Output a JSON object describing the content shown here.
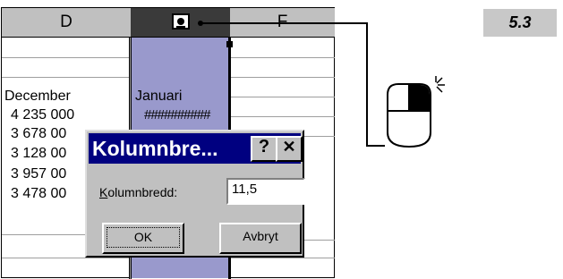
{
  "step_badge": "5.3",
  "spreadsheet": {
    "columns": [
      {
        "label": "D"
      },
      {
        "label": "",
        "selected": true
      },
      {
        "label": "F"
      }
    ],
    "header_row": {
      "d": "December",
      "e": "Januari"
    },
    "rows": [
      {
        "d": "4 235 000",
        "e": "##########"
      },
      {
        "d": "3 678 00",
        "e": ""
      },
      {
        "d": "3 128 00",
        "e": ""
      },
      {
        "d": "3 957 00",
        "e": ""
      },
      {
        "d": "3 478 00",
        "e": ""
      }
    ],
    "selected_column_color": "#9999cc"
  },
  "dialog": {
    "title": "Kolumnbre...",
    "help_button": "?",
    "close_button": "✕",
    "field_label": "Kolumnbredd:",
    "field_value": "11,5",
    "ok_label": "OK",
    "cancel_label": "Avbryt"
  },
  "icons": {
    "resize_cursor": "column-resize-cursor-icon",
    "mouse": "mouse-left-click-icon"
  }
}
